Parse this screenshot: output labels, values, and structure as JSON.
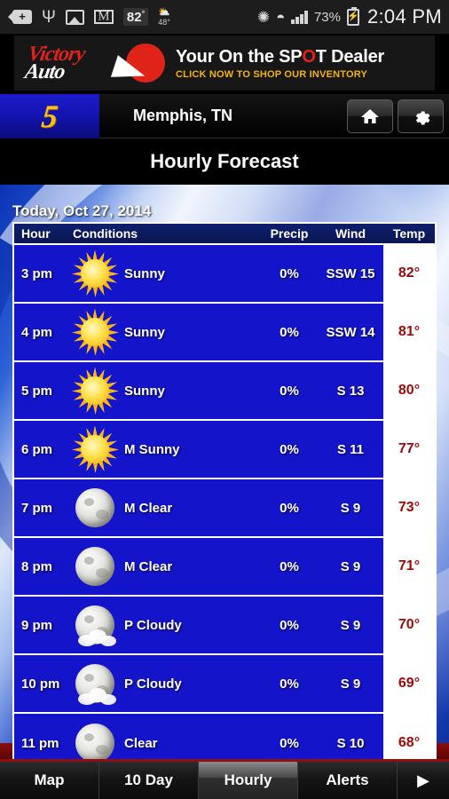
{
  "statusbar": {
    "icons": [
      "back-icon",
      "usb-icon",
      "gallery-icon",
      "gmail-icon"
    ],
    "temp_badge": "82",
    "temp_badge_unit": "°",
    "weather_widget_icon": "⛅",
    "weather_widget_temp": "48°",
    "bluetooth_icon": "ᛦ",
    "wifi_icon": "▼",
    "battery_percent": "73%",
    "clock": "2:04 PM"
  },
  "ad": {
    "brand_line1": "Victory",
    "brand_line2": "Auto",
    "headline_a": "Your On the SP",
    "headline_o": "O",
    "headline_b": "T Dealer",
    "subline": "CLICK NOW TO SHOP OUR INVENTORY"
  },
  "header": {
    "logo": "5",
    "city": "Memphis, TN",
    "home_label": "Home",
    "settings_label": "Settings",
    "subtitle": "Hourly Forecast"
  },
  "forecast": {
    "date_label": "Today, Oct 27, 2014",
    "columns": [
      "Hour",
      "Conditions",
      "Precip",
      "Wind",
      "Temp"
    ],
    "rows": [
      {
        "hour": "3 pm",
        "icon": "sun",
        "condition": "Sunny",
        "precip": "0%",
        "wind": "SSW 15",
        "temp": "82°"
      },
      {
        "hour": "4 pm",
        "icon": "sun",
        "condition": "Sunny",
        "precip": "0%",
        "wind": "SSW 14",
        "temp": "81°"
      },
      {
        "hour": "5 pm",
        "icon": "sun",
        "condition": "Sunny",
        "precip": "0%",
        "wind": "S 13",
        "temp": "80°"
      },
      {
        "hour": "6 pm",
        "icon": "sun",
        "condition": "M Sunny",
        "precip": "0%",
        "wind": "S 11",
        "temp": "77°"
      },
      {
        "hour": "7 pm",
        "icon": "moon",
        "condition": "M Clear",
        "precip": "0%",
        "wind": "S 9",
        "temp": "73°"
      },
      {
        "hour": "8 pm",
        "icon": "moon",
        "condition": "M Clear",
        "precip": "0%",
        "wind": "S 9",
        "temp": "71°"
      },
      {
        "hour": "9 pm",
        "icon": "moon-cloud",
        "condition": "P Cloudy",
        "precip": "0%",
        "wind": "S 9",
        "temp": "70°"
      },
      {
        "hour": "10 pm",
        "icon": "moon-cloud",
        "condition": "P Cloudy",
        "precip": "0%",
        "wind": "S 9",
        "temp": "69°"
      },
      {
        "hour": "11 pm",
        "icon": "moon",
        "condition": "Clear",
        "precip": "0%",
        "wind": "S 10",
        "temp": "68°"
      }
    ]
  },
  "nav": {
    "tabs": [
      {
        "label": "Map",
        "selected": false
      },
      {
        "label": "10 Day",
        "selected": false
      },
      {
        "label": "Hourly",
        "selected": true
      },
      {
        "label": "Alerts",
        "selected": false
      }
    ],
    "more_arrow": "▶"
  },
  "colors": {
    "row_blue": "#1414cb",
    "temp_red": "#9e0808",
    "header_navy": "#0e1f6e",
    "accent_red": "#8f0f0f",
    "logo_gold": "#fcbf1a"
  }
}
